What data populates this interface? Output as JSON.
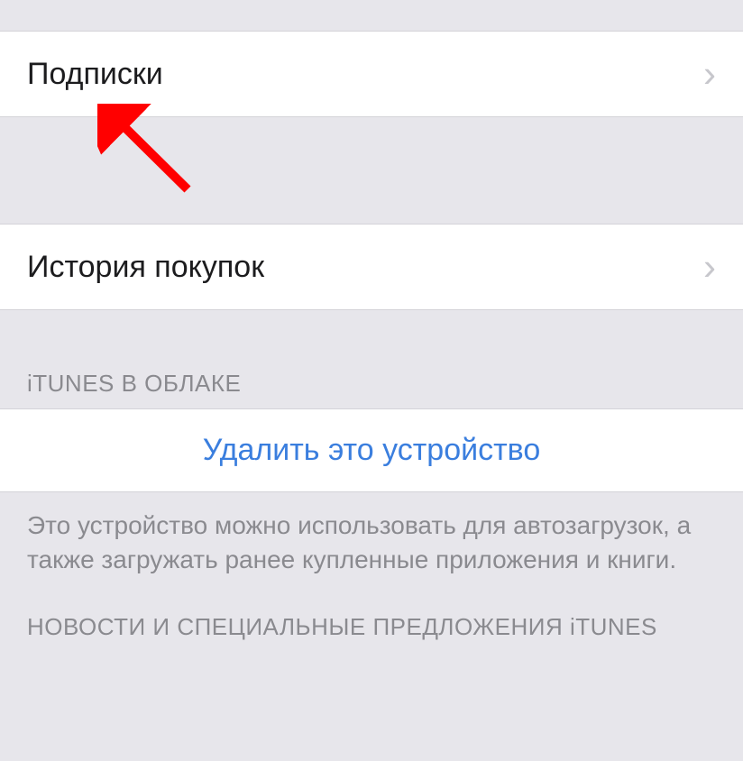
{
  "rows": {
    "subscriptions": {
      "label": "Подписки"
    },
    "purchase_history": {
      "label": "История покупок"
    }
  },
  "sections": {
    "itunes_cloud": {
      "header": "iTUNES В ОБЛАКЕ"
    },
    "news_offers": {
      "header": "НОВОСТИ И СПЕЦИАЛЬНЫЕ ПРЕДЛОЖЕНИЯ iTUNES"
    }
  },
  "actions": {
    "remove_device": {
      "label": "Удалить это устройство"
    }
  },
  "footers": {
    "device_info": "Это устройство можно использовать для автозагрузок, а также загружать ранее купленные приложения и книги."
  }
}
